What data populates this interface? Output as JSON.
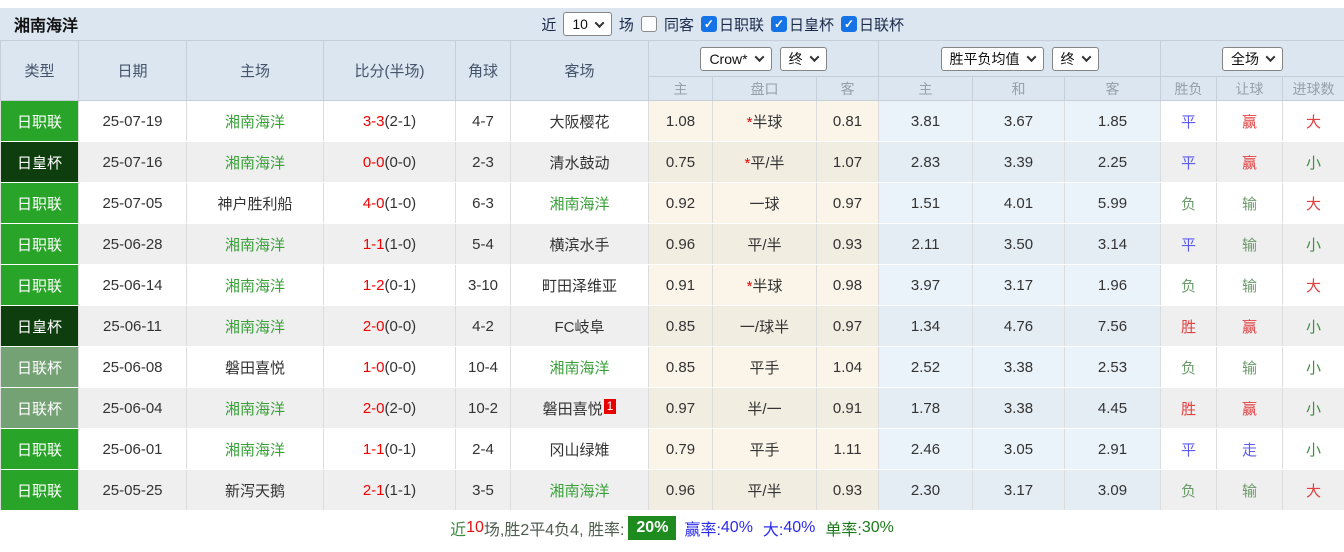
{
  "topbar": {
    "title": "湘南海洋",
    "recent_label": "近",
    "recent_value": "10",
    "matches_label": "场",
    "same_venue_label": "同客",
    "same_venue_checked": false,
    "leagues": [
      {
        "label": "日职联",
        "checked": true
      },
      {
        "label": "日皇杯",
        "checked": true
      },
      {
        "label": "日联杯",
        "checked": true
      }
    ]
  },
  "table": {
    "columns": [
      "类型",
      "日期",
      "主场",
      "比分(半场)",
      "角球",
      "客场"
    ],
    "selects": {
      "bookmaker": "Crow*",
      "bookmaker_stage": "终",
      "avg": "胜平负均值",
      "avg_stage": "终",
      "scope": "全场"
    },
    "subcolumns": [
      "主",
      "盘口",
      "客",
      "主",
      "和",
      "客",
      "胜负",
      "让球",
      "进球数"
    ],
    "rows": [
      {
        "league": "日职联",
        "date": "25-07-19",
        "home": "湘南海洋",
        "score": "3-3",
        "half": "(2-1)",
        "corners": "4-7",
        "away": "大阪樱花",
        "away_badge": "",
        "star": true,
        "ah_home": "1.08",
        "ah_line": "半球",
        "ah_away": "0.81",
        "eu_home": "3.81",
        "eu_draw": "3.67",
        "eu_away": "1.85",
        "result": "平",
        "handicap": "赢",
        "goals": "大"
      },
      {
        "league": "日皇杯",
        "date": "25-07-16",
        "home": "湘南海洋",
        "score": "0-0",
        "half": "(0-0)",
        "corners": "2-3",
        "away": "清水鼓动",
        "away_badge": "",
        "star": true,
        "ah_home": "0.75",
        "ah_line": "平/半",
        "ah_away": "1.07",
        "eu_home": "2.83",
        "eu_draw": "3.39",
        "eu_away": "2.25",
        "result": "平",
        "handicap": "赢",
        "goals": "小"
      },
      {
        "league": "日职联",
        "date": "25-07-05",
        "home": "神户胜利船",
        "score": "4-0",
        "half": "(1-0)",
        "corners": "6-3",
        "away": "湘南海洋",
        "away_badge": "",
        "star": false,
        "ah_home": "0.92",
        "ah_line": "一球",
        "ah_away": "0.97",
        "eu_home": "1.51",
        "eu_draw": "4.01",
        "eu_away": "5.99",
        "result": "负",
        "handicap": "输",
        "goals": "大"
      },
      {
        "league": "日职联",
        "date": "25-06-28",
        "home": "湘南海洋",
        "score": "1-1",
        "half": "(1-0)",
        "corners": "5-4",
        "away": "横滨水手",
        "away_badge": "",
        "star": false,
        "ah_home": "0.96",
        "ah_line": "平/半",
        "ah_away": "0.93",
        "eu_home": "2.11",
        "eu_draw": "3.50",
        "eu_away": "3.14",
        "result": "平",
        "handicap": "输",
        "goals": "小"
      },
      {
        "league": "日职联",
        "date": "25-06-14",
        "home": "湘南海洋",
        "score": "1-2",
        "half": "(0-1)",
        "corners": "3-10",
        "away": "町田泽维亚",
        "away_badge": "",
        "star": true,
        "ah_home": "0.91",
        "ah_line": "半球",
        "ah_away": "0.98",
        "eu_home": "3.97",
        "eu_draw": "3.17",
        "eu_away": "1.96",
        "result": "负",
        "handicap": "输",
        "goals": "大"
      },
      {
        "league": "日皇杯",
        "date": "25-06-11",
        "home": "湘南海洋",
        "score": "2-0",
        "half": "(0-0)",
        "corners": "4-2",
        "away": "FC岐阜",
        "away_badge": "",
        "star": false,
        "ah_home": "0.85",
        "ah_line": "一/球半",
        "ah_away": "0.97",
        "eu_home": "1.34",
        "eu_draw": "4.76",
        "eu_away": "7.56",
        "result": "胜",
        "handicap": "赢",
        "goals": "小"
      },
      {
        "league": "日联杯",
        "date": "25-06-08",
        "home": "磐田喜悦",
        "score": "1-0",
        "half": "(0-0)",
        "corners": "10-4",
        "away": "湘南海洋",
        "away_badge": "",
        "star": false,
        "ah_home": "0.85",
        "ah_line": "平手",
        "ah_away": "1.04",
        "eu_home": "2.52",
        "eu_draw": "3.38",
        "eu_away": "2.53",
        "result": "负",
        "handicap": "输",
        "goals": "小"
      },
      {
        "league": "日联杯",
        "date": "25-06-04",
        "home": "湘南海洋",
        "score": "2-0",
        "half": "(2-0)",
        "corners": "10-2",
        "away": "磐田喜悦",
        "away_badge": "1",
        "star": false,
        "ah_home": "0.97",
        "ah_line": "半/一",
        "ah_away": "0.91",
        "eu_home": "1.78",
        "eu_draw": "3.38",
        "eu_away": "4.45",
        "result": "胜",
        "handicap": "赢",
        "goals": "小"
      },
      {
        "league": "日职联",
        "date": "25-06-01",
        "home": "湘南海洋",
        "score": "1-1",
        "half": "(0-1)",
        "corners": "2-4",
        "away": "冈山绿雉",
        "away_badge": "",
        "star": false,
        "ah_home": "0.79",
        "ah_line": "平手",
        "ah_away": "1.11",
        "eu_home": "2.46",
        "eu_draw": "3.05",
        "eu_away": "2.91",
        "result": "平",
        "handicap": "走",
        "goals": "小"
      },
      {
        "league": "日职联",
        "date": "25-05-25",
        "home": "新泻天鹅",
        "score": "2-1",
        "half": "(1-1)",
        "corners": "3-5",
        "away": "湘南海洋",
        "away_badge": "",
        "star": false,
        "ah_home": "0.96",
        "ah_line": "平/半",
        "ah_away": "0.93",
        "eu_home": "2.30",
        "eu_draw": "3.17",
        "eu_away": "3.09",
        "result": "负",
        "handicap": "输",
        "goals": "大"
      }
    ]
  },
  "league_colors": {
    "日职联": "#28a428",
    "日皇杯": "#0e3d0e",
    "日联杯": "#74a274"
  },
  "value_colors": {
    "胜": "red",
    "平": "blue",
    "负": "green",
    "赢": "red",
    "输": "green",
    "走": "blue",
    "大": "red",
    "小": "green2"
  },
  "summary": {
    "recent_label": "近",
    "recent_count": "10",
    "record_text": "场,胜2平4负4, 胜率:",
    "win_rate_badge": "20%",
    "handicap_rate_label": "赢率:",
    "handicap_rate": "40%",
    "big_rate_label": "大:",
    "big_rate": "40%",
    "single_rate_label": "单率:",
    "single_rate": "30%"
  }
}
